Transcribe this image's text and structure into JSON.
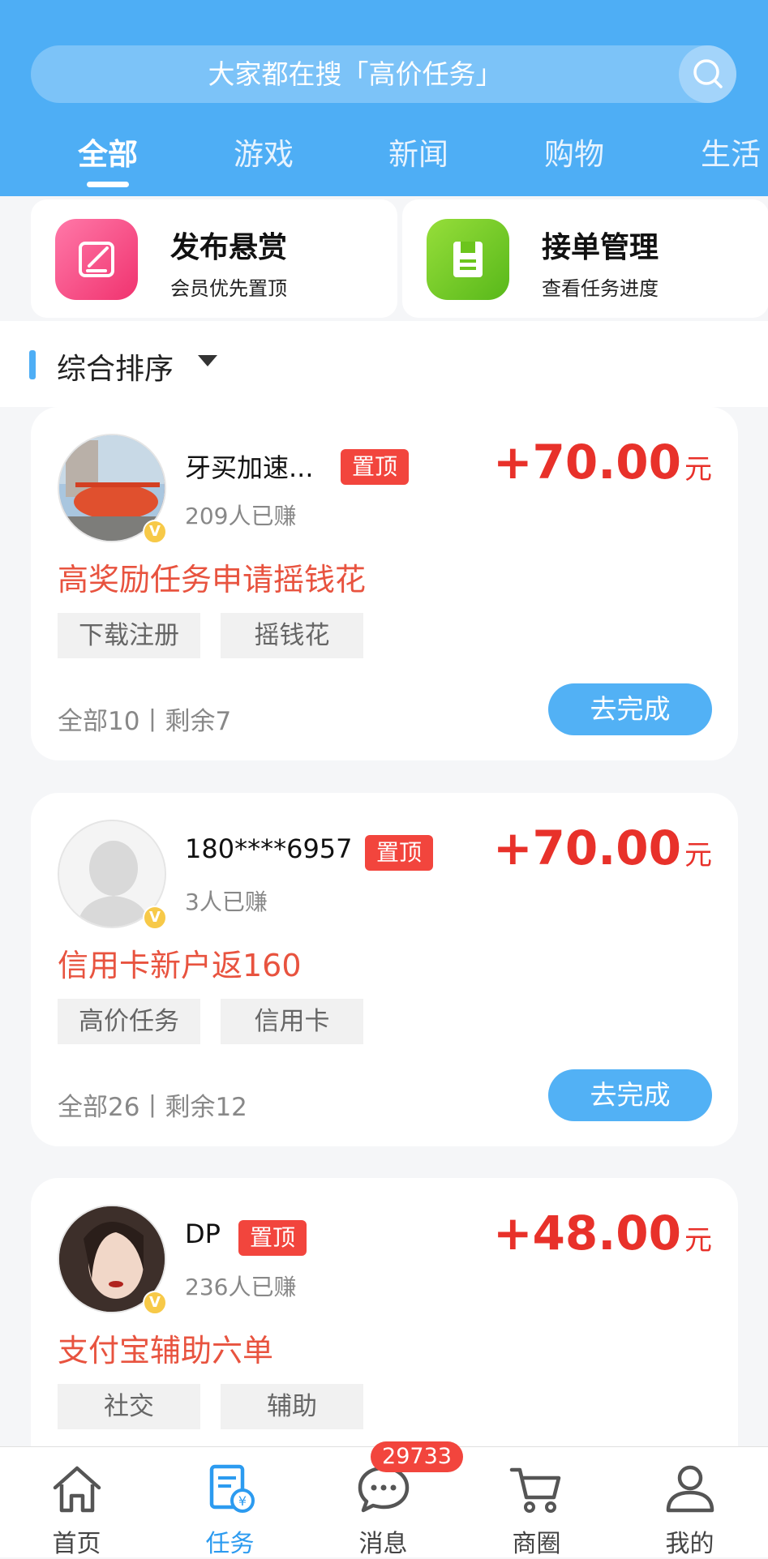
{
  "search": {
    "placeholder": "大家都在搜「高价任务」",
    "icon": "search-icon"
  },
  "tabs": [
    {
      "label": "全部",
      "active": true
    },
    {
      "label": "游戏",
      "active": false
    },
    {
      "label": "新闻",
      "active": false
    },
    {
      "label": "购物",
      "active": false
    },
    {
      "label": "生活",
      "active": false
    }
  ],
  "quick_actions": [
    {
      "title": "发布悬赏",
      "subtitle": "会员优先置顶",
      "icon": "edit-icon",
      "color": "#f53f7f"
    },
    {
      "title": "接单管理",
      "subtitle": "查看任务进度",
      "icon": "clipboard-icon",
      "color": "#6cc51d"
    }
  ],
  "sort": {
    "label": "综合排序"
  },
  "tasks": [
    {
      "username": "牙买加速...",
      "pin_label": "置顶",
      "earned": "209人已赚",
      "amount": "+70.00",
      "unit": "元",
      "title": "高奖励任务申请摇钱花",
      "tags": [
        "下载注册",
        "摇钱花"
      ],
      "counts": "全部10丨剩余7",
      "button": "去完成",
      "badge": "V"
    },
    {
      "username": "180****6957",
      "pin_label": "置顶",
      "earned": "3人已赚",
      "amount": "+70.00",
      "unit": "元",
      "title": "信用卡新户返160",
      "tags": [
        "高价任务",
        "信用卡"
      ],
      "counts": "全部26丨剩余12",
      "button": "去完成",
      "badge": "V"
    },
    {
      "username": "DP",
      "pin_label": "置顶",
      "earned": "236人已赚",
      "amount": "+48.00",
      "unit": "元",
      "title": "支付宝辅助六单",
      "tags": [
        "社交",
        "辅助"
      ],
      "counts": "",
      "button": "",
      "badge": "V"
    }
  ],
  "bottom_nav": [
    {
      "label": "首页",
      "icon": "home-icon",
      "active": false
    },
    {
      "label": "任务",
      "icon": "task-icon",
      "active": true
    },
    {
      "label": "消息",
      "icon": "message-icon",
      "active": false,
      "badge": "29733"
    },
    {
      "label": "商圈",
      "icon": "cart-icon",
      "active": false
    },
    {
      "label": "我的",
      "icon": "user-icon",
      "active": false
    }
  ],
  "colors": {
    "primary": "#4eaef5",
    "reward": "#e8312a",
    "pin": "#f2453d"
  }
}
